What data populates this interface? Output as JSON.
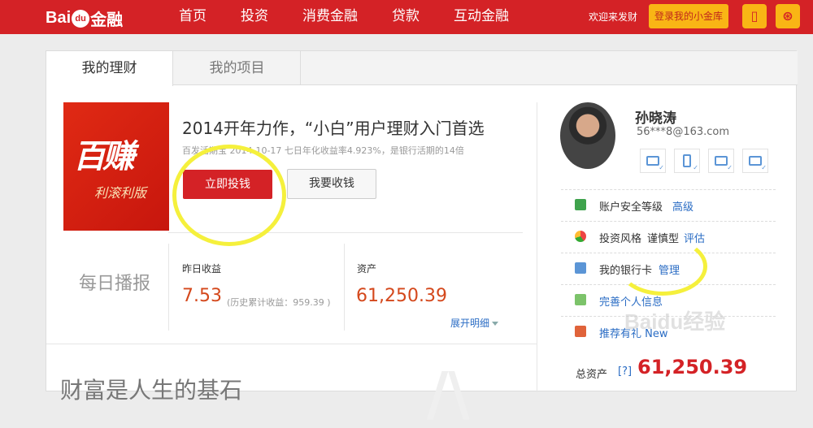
{
  "brand": {
    "logo_text_1": "Bai",
    "logo_paw": "du",
    "logo_text_2": "金融"
  },
  "nav": {
    "items": [
      "首页",
      "投资",
      "消费金融",
      "贷款",
      "互动金融"
    ]
  },
  "header": {
    "welcome": "欢迎来发财",
    "login_label": "登录我的小金库",
    "phone_icon": "phone-icon",
    "weibo_icon": "weibo-icon"
  },
  "tabs": [
    "我的理财",
    "我的项目"
  ],
  "product": {
    "image_text": "百赚",
    "image_subtext": "利滚利版",
    "title": "2014开年力作，“小白”用户理财入门首选",
    "subtitle": "百发活期宝 2014-10-17 七日年化收益率4.923%，是银行活期的14倍",
    "invest_button": "立即投钱",
    "withdraw_button": "我要收钱"
  },
  "daily": {
    "title": "每日播报",
    "yesterday_label": "昨日收益",
    "yesterday_value": "7.53",
    "history_note": "(历史累计收益：959.39 )",
    "assets_label": "资产",
    "assets_value": "61,250.39",
    "expand_label": "展开明细"
  },
  "slogan": "财富是人生的基石",
  "user": {
    "name": "孙晓涛",
    "email": "56***8@163.com",
    "verify_icons": [
      "id-card-icon",
      "mobile-icon",
      "bank-card-icon",
      "mail-icon"
    ]
  },
  "side": {
    "security_label": "账户安全等级",
    "security_value": "高级",
    "risk_label": "投资风格",
    "risk_mid": "谨慎型",
    "risk_link": "评估",
    "bank_label": "我的银行卡",
    "bank_link": "管理",
    "profile_link": "完善个人信息",
    "recommend_link": "推荐有礼 New",
    "total_label": "总资产",
    "total_help": "[?]",
    "total_value": "61,250.39"
  },
  "watermark": "Baidu经验",
  "colors": {
    "brand_red": "#d42226",
    "accent_yellow": "#f9b515",
    "value_orange": "#d4481c",
    "link_blue": "#2a6cc4",
    "annotation_yellow": "#f5f03c"
  }
}
